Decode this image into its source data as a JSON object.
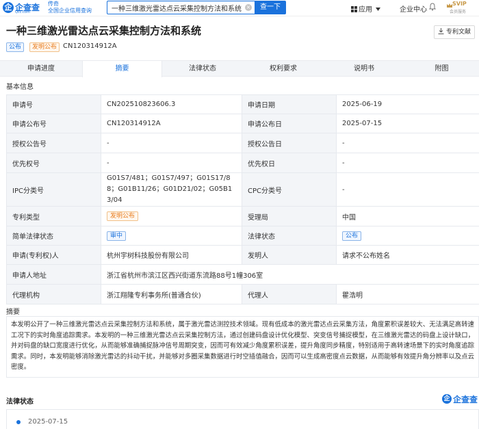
{
  "header": {
    "logo_text": "企查查",
    "logo_mark": "企",
    "logo_sub": "Qcc.com",
    "slogan_line1": "传奇",
    "slogan_line2": "全国企业信用查询",
    "search_value": "一种三维激光雷达点云采集控制方法和系统",
    "search_button": "查一下",
    "clear_glyph": "×",
    "nav_apps": "应用",
    "nav_enterprise_center": "企业中心",
    "svip_label": "SVIP",
    "svip_sub": "会员服务"
  },
  "patent": {
    "title": "一种三维激光雷达点云采集控制方法和系统",
    "download_label": "专利文献",
    "tags": [
      "公布",
      "发明公布"
    ],
    "publication_no": "CN120314912A"
  },
  "tabs": [
    {
      "label": "申请进度",
      "active": false
    },
    {
      "label": "摘要",
      "active": true
    },
    {
      "label": "法律状态",
      "active": false
    },
    {
      "label": "权利要求",
      "active": false
    },
    {
      "label": "说明书",
      "active": false
    },
    {
      "label": "附图",
      "active": false
    }
  ],
  "basic_info": {
    "heading": "基本信息",
    "rows": [
      {
        "l1": "申请号",
        "v1": "CN202510823606.3",
        "l2": "申请日期",
        "v2": "2025-06-19"
      },
      {
        "l1": "申请公布号",
        "v1": "CN120314912A",
        "l2": "申请公布日",
        "v2": "2025-07-15"
      },
      {
        "l1": "授权公告号",
        "v1": "-",
        "l2": "授权公告日",
        "v2": "-"
      },
      {
        "l1": "优先权号",
        "v1": "-",
        "l2": "优先权日",
        "v2": "-"
      },
      {
        "l1": "IPC分类号",
        "v1": "G01S7/481；G01S7/497；G01S17/88；G01B11/26；G01D21/02；G05B13/04",
        "l2": "CPC分类号",
        "v2": "-"
      },
      {
        "l1": "专利类型",
        "v1": "发明公布",
        "l2": "受理局",
        "v2": "中国"
      },
      {
        "l1": "简单法律状态",
        "v1": "审中",
        "l2": "法律状态",
        "v2": "公布"
      },
      {
        "l1": "申请(专利权)人",
        "v1": "杭州宇树科技股份有限公司",
        "l2": "发明人",
        "v2": "请求不公布姓名"
      },
      {
        "l1": "申请人地址",
        "v1": "浙江省杭州市滨江区西兴街道东流路88号1幢306室"
      },
      {
        "l1": "代理机构",
        "v1": "浙江翔隆专利事务所(普通合伙)",
        "l2": "代理人",
        "v2": "瞿浩明"
      }
    ]
  },
  "abstract": {
    "heading": "摘要",
    "text": "本发明公开了一种三维激光雷达点云采集控制方法和系统，属于激光雷达测控技术领域。现有低成本的激光雷达点云采集方法，角度累积误差较大、无法满足高转速工况下的实时角度追踪需求。本发明的一种三维激光雷达点云采集控制方法，通过创建码盘设计优化模型、突变信号捕捉模型，在三维激光雷达的码盘上设计缺口，并对码盘的缺口宽度进行优化，从而能够准确捕捉脉冲信号周期突变，因而可有效减少角度累积误差，提升角度同步精度，特别适用于高转速场景下的实时角度追踪需求。同时，本发明能够消除激光雷达的抖动干扰，并能够对多圈采集数据进行时空插值融合，因而可以生成高密度点云数据，从而能够有效提升角分辨率以及点云密度。"
  },
  "legal_status": {
    "heading": "法律状态",
    "logo_text": "企查查",
    "logo_mark": "企",
    "entries": [
      {
        "date": "2025-07-15"
      }
    ]
  }
}
